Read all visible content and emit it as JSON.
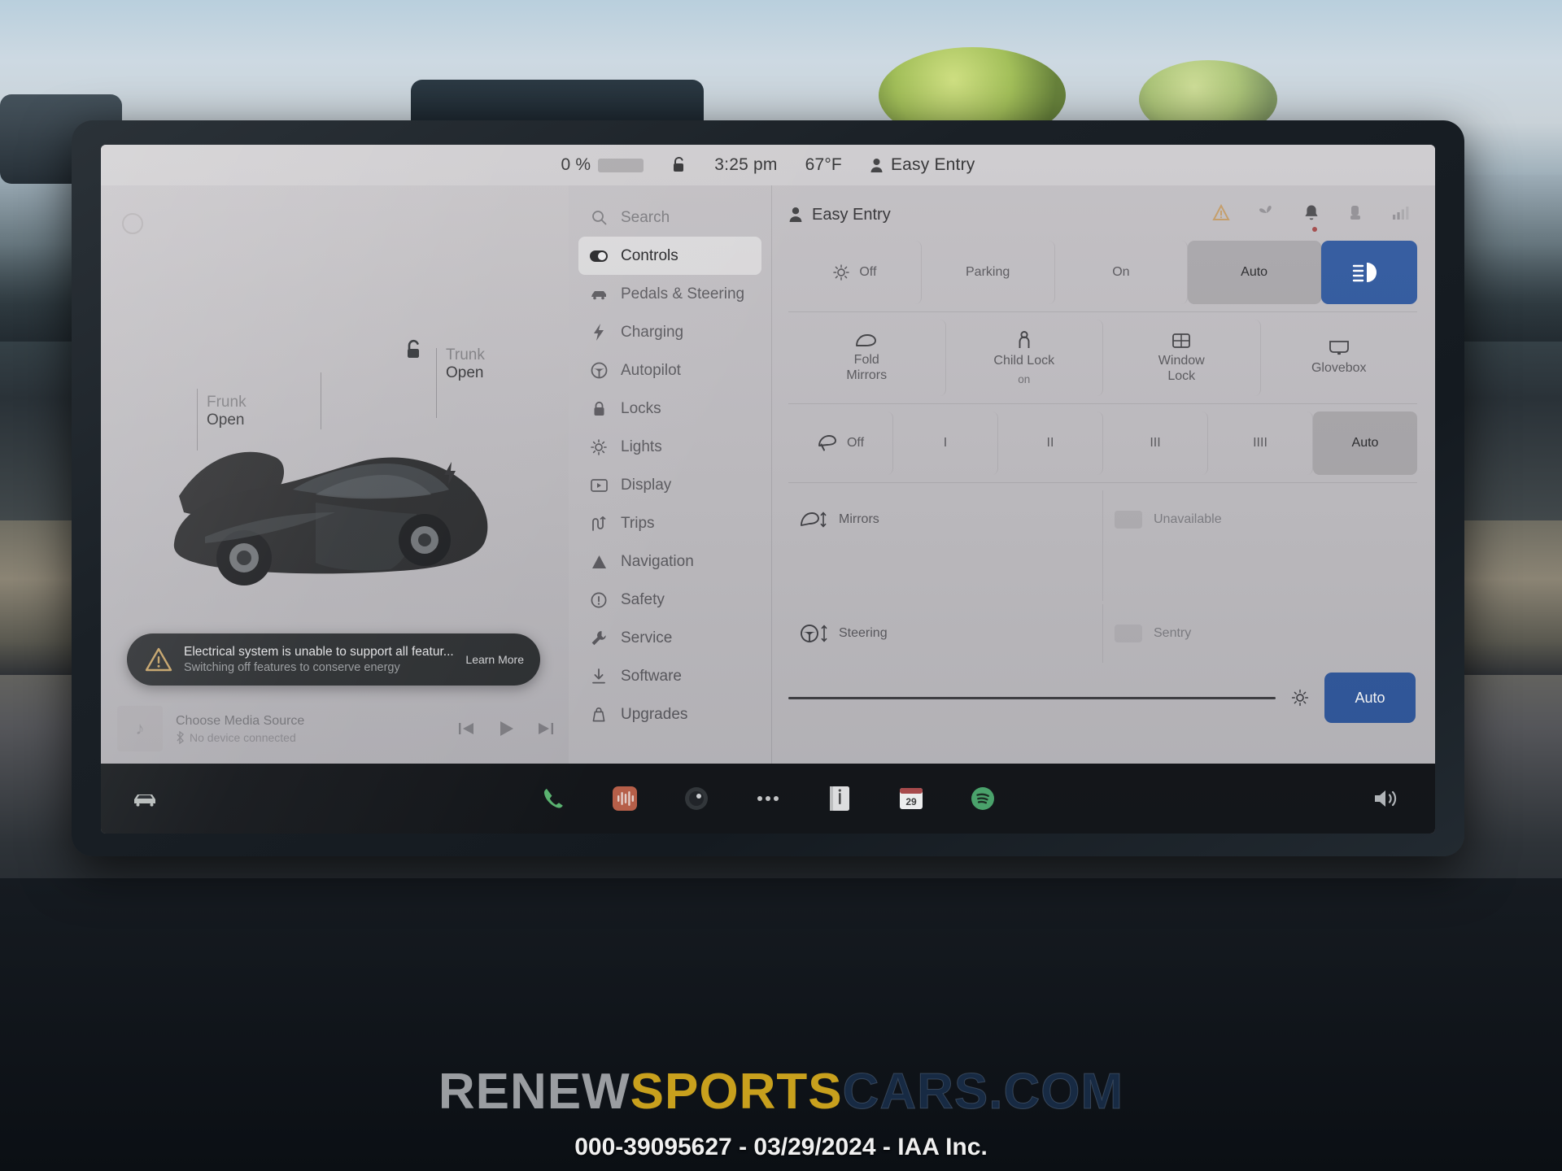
{
  "status_bar": {
    "battery_percent": "0 %",
    "lock_icon": "unlock-icon",
    "time": "3:25 pm",
    "temperature": "67°F",
    "profile_icon": "person-icon",
    "profile_name": "Easy Entry"
  },
  "car_view": {
    "badge_icon": "circle-icon",
    "unlock_icon": "unlock-icon",
    "frunk": {
      "title": "Frunk",
      "state": "Open"
    },
    "trunk": {
      "title": "Trunk",
      "state": "Open"
    },
    "charge_port_icon": "charge-bolt-icon"
  },
  "alert": {
    "warning_icon": "warning-triangle-icon",
    "title": "Electrical system is unable to support all featur...",
    "subtitle": "Switching off features to conserve energy",
    "action_label": "Learn More"
  },
  "media": {
    "art_icon": "music-note-icon",
    "title": "Choose Media Source",
    "device_icon": "bluetooth-icon",
    "subtitle": "No device connected",
    "prev_icon": "skip-previous-icon",
    "play_icon": "play-icon",
    "next_icon": "skip-next-icon"
  },
  "menu": {
    "search": {
      "label": "Search",
      "icon": "search-icon"
    },
    "items": [
      {
        "label": "Controls",
        "icon": "toggle-icon",
        "active": true
      },
      {
        "label": "Pedals & Steering",
        "icon": "car-icon",
        "active": false
      },
      {
        "label": "Charging",
        "icon": "bolt-icon",
        "active": false
      },
      {
        "label": "Autopilot",
        "icon": "steering-wheel-icon",
        "active": false
      },
      {
        "label": "Locks",
        "icon": "lock-icon",
        "active": false
      },
      {
        "label": "Lights",
        "icon": "sun-icon",
        "active": false
      },
      {
        "label": "Display",
        "icon": "display-icon",
        "active": false
      },
      {
        "label": "Trips",
        "icon": "trips-icon",
        "active": false
      },
      {
        "label": "Navigation",
        "icon": "navigation-arrow-icon",
        "active": false
      },
      {
        "label": "Safety",
        "icon": "info-circle-icon",
        "active": false
      },
      {
        "label": "Service",
        "icon": "wrench-icon",
        "active": false
      },
      {
        "label": "Software",
        "icon": "download-icon",
        "active": false
      },
      {
        "label": "Upgrades",
        "icon": "bag-icon",
        "active": false
      }
    ]
  },
  "controls": {
    "header": {
      "profile_icon": "person-icon",
      "profile_name": "Easy Entry",
      "icons": [
        "hazard-warning-icon",
        "fan-icon",
        "bell-icon",
        "seat-heat-icon",
        "signal-icon"
      ]
    },
    "lights_row": {
      "off": {
        "label": "Off",
        "icon": "headlight-sun-icon"
      },
      "parking": {
        "label": "Parking"
      },
      "on": {
        "label": "On"
      },
      "auto": {
        "label": "Auto",
        "selected": true
      },
      "highbeam": {
        "icon": "high-beam-icon",
        "accent": "#1456c8"
      }
    },
    "quick_row": [
      {
        "label": "Fold",
        "label2": "Mirrors",
        "icon": "mirror-icon"
      },
      {
        "label": "Child Lock",
        "sub": "on",
        "icon": "child-lock-icon"
      },
      {
        "label": "Window",
        "label2": "Lock",
        "icon": "window-lock-icon"
      },
      {
        "label": "Glovebox",
        "icon": "glovebox-icon"
      }
    ],
    "wiper_row": {
      "off": {
        "label": "Off",
        "icon": "wiper-icon"
      },
      "speeds": [
        "I",
        "II",
        "III",
        "IIII"
      ],
      "auto": {
        "label": "Auto",
        "selected": true
      }
    },
    "mirrors_row": {
      "label": "Mirrors",
      "icon": "mirror-adjust-icon"
    },
    "unavailable_label": "Unavailable",
    "steering_row": {
      "label": "Steering",
      "icon": "steering-adjust-icon"
    },
    "sentry_label": "Sentry",
    "brightness": {
      "slider_icon": "brightness-sun-icon",
      "auto_label": "Auto",
      "accent": "#1456c8"
    }
  },
  "dock": {
    "car_icon": "car-front-icon",
    "apps": [
      {
        "name": "phone-icon",
        "color": "#2ecc52"
      },
      {
        "name": "audio-icon",
        "color": "#f1542a"
      },
      {
        "name": "dashcam-icon",
        "color": "#32383e"
      },
      {
        "name": "more-icon",
        "color": "#cfcfcf"
      },
      {
        "name": "notes-icon",
        "color": "#e8e8e8"
      },
      {
        "name": "calendar-icon",
        "color": "#ffffff",
        "badge": "29"
      },
      {
        "name": "spotify-icon",
        "color": "#1db954"
      }
    ],
    "volume_icon": "volume-icon"
  },
  "watermark": {
    "part1": "RENEW",
    "part2": "SPORTS",
    "part3": "CARS.COM",
    "color1": "#bec1c4",
    "color2": "#d8ac1e",
    "color3": "#182d48"
  },
  "footer": {
    "text": "000-39095627 - 03/29/2024 - IAA Inc."
  }
}
